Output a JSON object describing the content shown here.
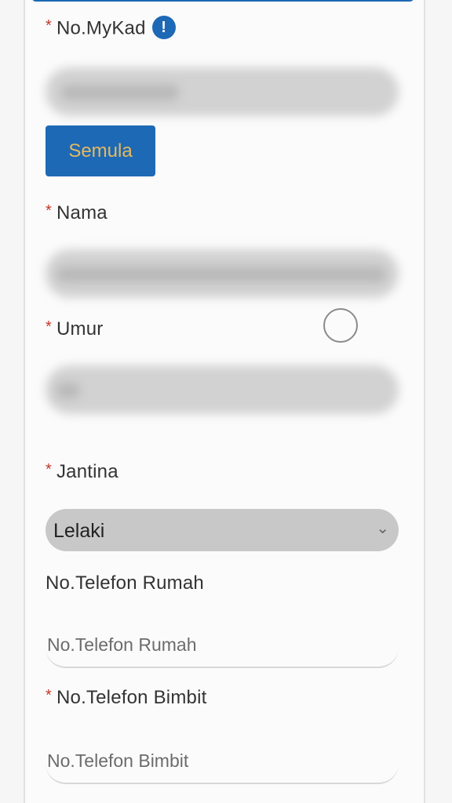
{
  "form": {
    "required_marker": "*",
    "mykad": {
      "label": "No.MyKad",
      "info_icon_glyph": "!"
    },
    "reset_button": {
      "label": "Semula"
    },
    "nama": {
      "label": "Nama"
    },
    "umur": {
      "label": "Umur"
    },
    "jantina": {
      "label": "Jantina",
      "selected": "Lelaki"
    },
    "telefon_rumah": {
      "label": "No.Telefon Rumah",
      "placeholder": "No.Telefon Rumah"
    },
    "telefon_bimbit": {
      "label": "No.Telefon Bimbit",
      "placeholder": "No.Telefon Bimbit"
    }
  },
  "colors": {
    "accent": "#1e69b5",
    "button_text": "#e6b95c",
    "required": "#c0392b"
  },
  "icons": {
    "info": "info-icon",
    "chevron": "chevron-down-icon",
    "loading": "loading-circle-icon"
  }
}
